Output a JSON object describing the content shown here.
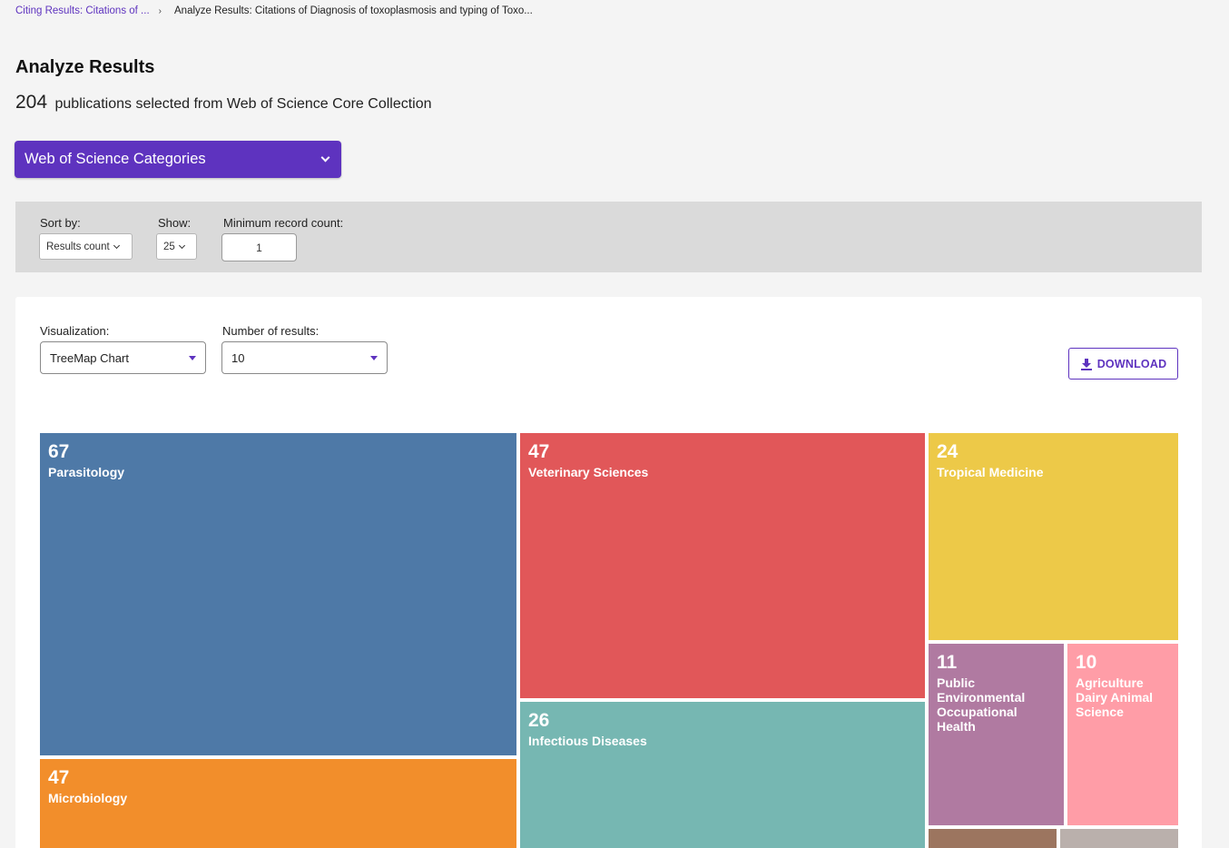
{
  "breadcrumb": {
    "parent": "Citing Results: Citations of ...",
    "separator": "›",
    "current": "Analyze Results: Citations of Diagnosis of toxoplasmosis and typing of Toxo..."
  },
  "header": {
    "title": "Analyze Results",
    "count": "204",
    "summary": "publications selected from Web of Science Core Collection"
  },
  "field_selector": {
    "label": "Web of Science Categories",
    "icon": "chevron-down-icon"
  },
  "filters": {
    "sort_label": "Sort by:",
    "sort_value": "Results count",
    "show_label": "Show:",
    "show_value": "25",
    "min_label": "Minimum record count:",
    "min_value": "1"
  },
  "visualization": {
    "viz_label": "Visualization:",
    "viz_value": "TreeMap Chart",
    "num_label": "Number of results:",
    "num_value": "10",
    "download_label": "DOWNLOAD",
    "download_icon": "download-icon"
  },
  "chart_data": {
    "type": "treemap",
    "tiles": [
      {
        "name": "Parasitology",
        "value": 67,
        "color": "#4e79a7"
      },
      {
        "name": "Veterinary Sciences",
        "value": 47,
        "color": "#e15759"
      },
      {
        "name": "Microbiology",
        "value": 47,
        "color": "#f28e2b"
      },
      {
        "name": "Infectious Diseases",
        "value": 26,
        "color": "#76b7b2"
      },
      {
        "name": "Tropical Medicine",
        "value": 24,
        "color": "#edc948"
      },
      {
        "name": "Public Environmental Occupational Health",
        "value": 11,
        "color": "#b07aa1"
      },
      {
        "name": "Agriculture Dairy Animal Science",
        "value": 10,
        "color": "#ff9da7"
      },
      {
        "name": "",
        "value": null,
        "color": "#9c755f"
      },
      {
        "name": "",
        "value": null,
        "color": "#bab0ac"
      }
    ]
  }
}
